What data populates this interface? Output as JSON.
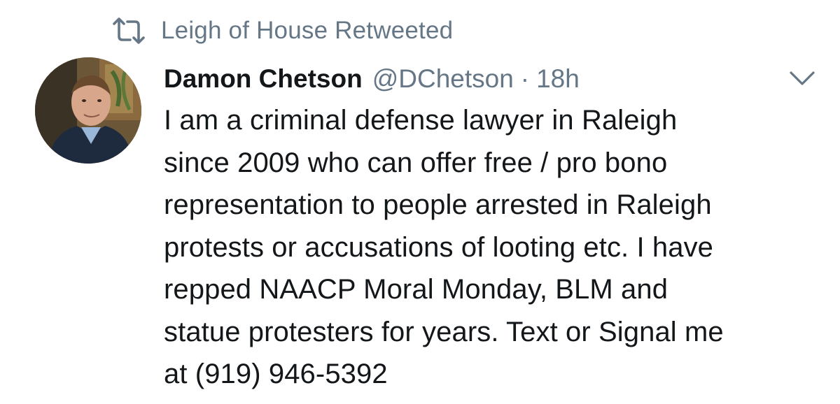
{
  "retweet": {
    "icon": "retweet-icon",
    "label": "Leigh of House Retweeted"
  },
  "tweet": {
    "display_name": "Damon Chetson",
    "handle": "@DChetson",
    "separator": "·",
    "timestamp": "18h",
    "caret_icon": "chevron-down-icon",
    "body_lines": [
      "I am a criminal defense lawyer in Raleigh",
      "since 2009 who can offer free / pro bono",
      "representation to people arrested in Raleigh",
      "protests or accusations of looting etc. I have",
      "repped NAACP Moral Monday, BLM and",
      "statue protesters for years. Text or Signal me",
      "at (919) 946-5392"
    ]
  },
  "colors": {
    "text_primary": "#14171a",
    "text_secondary": "#657786",
    "background": "#ffffff"
  }
}
